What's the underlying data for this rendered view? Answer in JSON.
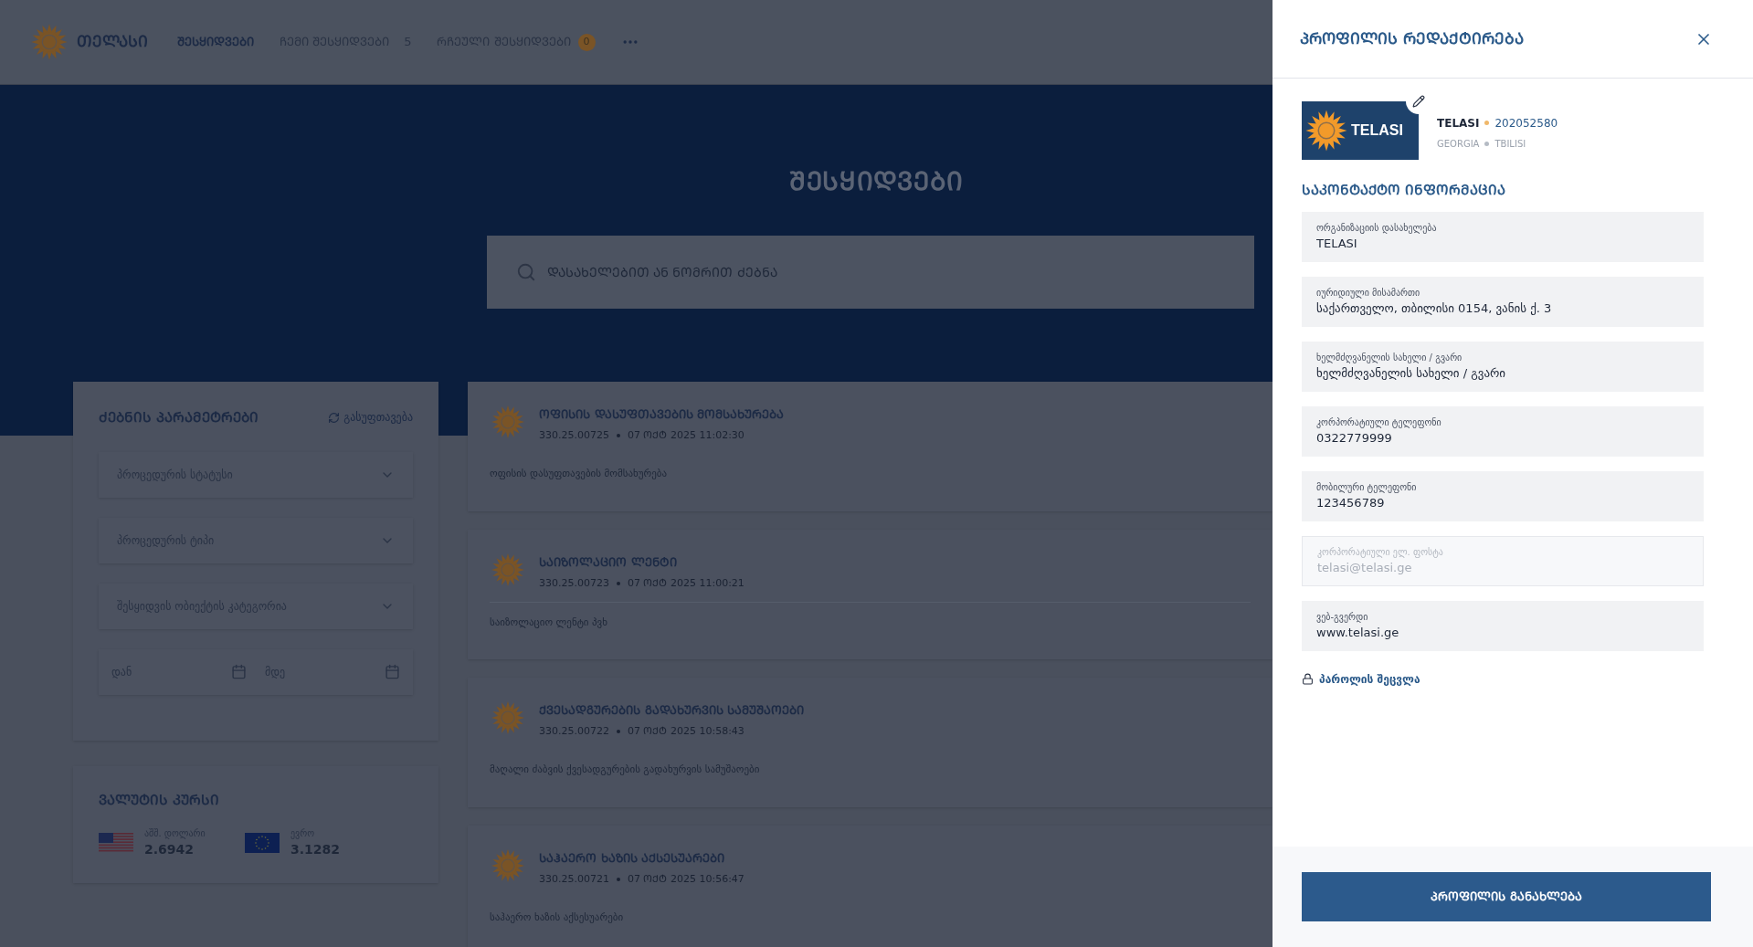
{
  "header": {
    "logo_text": "ᲗᲔᲚᲐᲡᲘ",
    "nav": [
      {
        "label": "ᲨᲔᲡᲧᲘᲓᲕᲔᲑᲘ",
        "selected": true
      },
      {
        "label": "ᲩᲔᲛᲘ ᲨᲔᲡᲧᲘᲓᲕᲔᲑᲘ",
        "count": "5",
        "selected": false
      },
      {
        "label": "ᲠᲩᲔᲣᲚᲘ ᲨᲔᲡᲧᲘᲓᲕᲔᲑᲘ",
        "badge": "0",
        "selected": false
      }
    ]
  },
  "hero": {
    "title": "ᲨᲔᲡᲧᲘᲓᲕᲔᲑᲘ",
    "search": {
      "placeholder": "ᲓᲐᲡᲐᲮᲔᲚᲔᲑᲘᲗ ᲐᲜ ᲜᲝᲛᲠᲘᲗ ᲫᲔᲑᲜᲐ"
    }
  },
  "filters": {
    "title": "ᲫᲔᲑᲜᲘᲡ ᲞᲐᲠᲐᲛᲔᲢᲠᲔᲑᲘ",
    "reset": "გასუფთავება",
    "selects": [
      "პროცედურის სტატუსი",
      "პროცედურის ტიპი",
      "შესყიდვის ობიექტის კატეგორია"
    ],
    "date_from": "დან",
    "date_to": "მდე"
  },
  "currency": {
    "title": "ᲕᲐᲚᲣᲢᲘᲡ ᲙᲣᲠᲡᲘ",
    "rates": [
      {
        "kind": "usd",
        "name": "აშშ. დოლარი",
        "rate": "2.6942"
      },
      {
        "kind": "eur",
        "name": "ევრო",
        "rate": "3.1282"
      }
    ]
  },
  "tenders": [
    {
      "title": "ᲝᲤᲘᲡᲘᲡ ᲓᲐᲡᲣᲤᲗᲐᲕᲔᲑᲘᲡ ᲛᲝᲛᲡᲐᲮᲣᲠᲔᲑᲐ",
      "number": "330.25.00725",
      "date": "07 ᲝᲥᲢ 2025 11:02:30",
      "description": "ოფისის დასუფთავების მომსახურება"
    },
    {
      "title": "ᲡᲐᲘᲖᲝᲚᲐᲪᲘᲝ ᲚᲔᲜᲢᲘ",
      "number": "330.25.00723",
      "date": "07 ᲝᲥᲢ 2025 11:00:21",
      "description": "საიზოლაციო ლენტი პვხ"
    },
    {
      "title": "ᲥᲕᲔᲡᲐᲓᲒᲣᲠᲔᲑᲘᲡ ᲒᲐᲓᲐᲮᲣᲠᲕᲘᲡ ᲡᲐᲛᲣᲨᲐᲝᲔᲑᲘ",
      "number": "330.25.00722",
      "date": "07 ᲝᲥᲢ 2025 10:58:43",
      "description": "მაღალი ძაბვის ქვესადგურების გადახურვის სამუშაოები"
    },
    {
      "title": "ᲡᲐᲰᲐᲔᲠᲝ ᲮᲐᲖᲘᲡ ᲐᲥᲡᲔᲡᲣᲐᲠᲔᲑᲘ",
      "number": "330.25.00721",
      "date": "07 ᲝᲥᲢ 2025 10:56:47",
      "description": "საჰაერო ხაზის აქსესუარები"
    }
  ],
  "profile": {
    "title": "ᲞᲠᲝᲤᲘᲚᲘᲡ ᲠᲔᲓᲐᲥᲢᲘᲠᲔᲑᲐ",
    "logo_text": "TELASI",
    "name": "TELASI",
    "code": "202052580",
    "country": "GEORGIA",
    "city": "TBILISI",
    "section_title": "ᲡᲐᲙᲝᲜᲢᲐᲥᲢᲝ ᲘᲜᲤᲝᲠᲛᲐᲪᲘᲐ",
    "fields": [
      {
        "label": "ორგანიზაციის დასახელება",
        "value": "TELASI",
        "disabled": false
      },
      {
        "label": "იურიდიული მისამართი",
        "value": "საქართველო, თბილისი 0154, ვანის ქ. 3",
        "disabled": false
      },
      {
        "label": "ხელმძღვანელის სახელი / გვარი",
        "value": "ხელმძღვანელის სახელი / გვარი",
        "disabled": false
      },
      {
        "label": "კორპორატიული ტელეფონი",
        "value": "0322779999",
        "disabled": false
      },
      {
        "label": "მობილური ტელეფონი",
        "value": "123456789",
        "disabled": false
      },
      {
        "label": "კორპორატიული ელ. ფოსტა",
        "value": "telasi@telasi.ge",
        "disabled": true
      },
      {
        "label": "ვებ-გვერდი",
        "value": "www.telasi.ge",
        "disabled": false
      }
    ],
    "password_link": "პაროლის შეცვლა",
    "save_button": "ᲞᲠᲝᲤᲘᲚᲘᲡ ᲒᲐᲜᲐᲮᲚᲔᲑᲐ"
  }
}
